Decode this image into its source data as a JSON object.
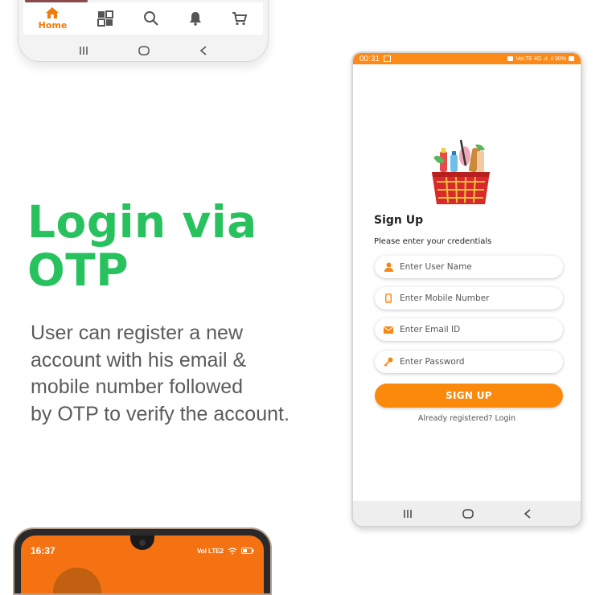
{
  "top_phone": {
    "nav": [
      {
        "icon": "home-icon",
        "label": "Home"
      },
      {
        "icon": "categories-icon"
      },
      {
        "icon": "search-icon"
      },
      {
        "icon": "bell-icon"
      },
      {
        "icon": "cart-icon"
      }
    ],
    "system_nav": [
      "recent-apps-icon",
      "home-circle-icon",
      "back-icon"
    ]
  },
  "headline": {
    "line1": "Login via",
    "line2": "OTP"
  },
  "description": {
    "line1": "User can register a new",
    "line2": "account with his email &",
    "line3": "mobile number followed",
    "line4": "by OTP to verify the account."
  },
  "main_phone": {
    "status": {
      "time": "00:31",
      "right": "VoLTE 4G .ıl .ıl 90%"
    },
    "signup": {
      "title": "Sign Up",
      "subtitle": "Please enter your credentials",
      "fields": {
        "username": {
          "placeholder": "Enter User Name",
          "icon": "user-icon"
        },
        "mobile": {
          "placeholder": "Enter Mobile Number",
          "icon": "phone-icon"
        },
        "email": {
          "placeholder": "Enter Email ID",
          "icon": "mail-icon"
        },
        "password": {
          "placeholder": "Enter Password",
          "icon": "key-icon"
        }
      },
      "button": "SIGN UP",
      "already": "Already registered? Login"
    }
  },
  "bottom_phone": {
    "status": {
      "time": "16:37",
      "right": "Vol LTE2"
    }
  },
  "colors": {
    "accent": "#fb8a18",
    "headline": "#27c25e",
    "text": "#5b5b5b"
  }
}
